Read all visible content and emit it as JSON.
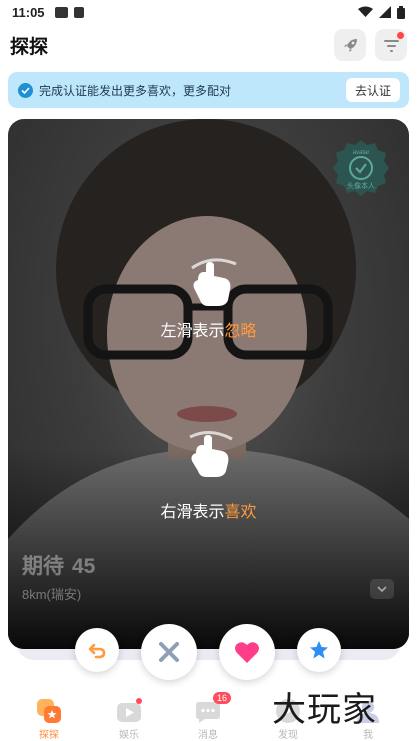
{
  "status_bar": {
    "time": "11:05"
  },
  "header": {
    "title": "探探"
  },
  "banner": {
    "text": "完成认证能发出更多喜欢，更多配对",
    "button": "去认证"
  },
  "card": {
    "badge_text_top": "avatar",
    "badge_text_bottom": "头像本人",
    "hint_left": {
      "prefix": "左滑表示",
      "accent": "忽略"
    },
    "hint_right": {
      "prefix": "右滑表示",
      "accent": "喜欢"
    },
    "name": "期待",
    "age": "45",
    "distance": "8km(瑞安)"
  },
  "actions": [
    {
      "icon": "undo-icon"
    },
    {
      "icon": "close-icon"
    },
    {
      "icon": "heart-icon"
    },
    {
      "icon": "star-icon"
    }
  ],
  "bottom_nav": {
    "items": [
      {
        "label": "探探",
        "icon": "explore-icon",
        "active": true
      },
      {
        "label": "娱乐",
        "icon": "play-icon",
        "dot": true
      },
      {
        "label": "消息",
        "icon": "message-icon",
        "badge": "16"
      },
      {
        "label": "发现",
        "icon": "discover-icon"
      },
      {
        "label": "我",
        "icon": "profile-icon"
      }
    ]
  },
  "watermark": "大玩家",
  "colors": {
    "accent": "#ff9a3d",
    "like": "#ff3d8b",
    "star": "#2f8ff0",
    "banner": "#bfe7fb"
  }
}
